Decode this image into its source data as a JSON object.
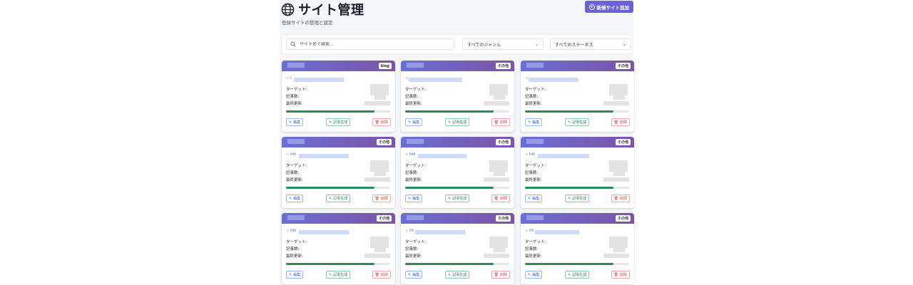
{
  "header": {
    "title": "サイト管理",
    "subtitle": "登録サイトの管理と設定",
    "add_button": "新規サイト追加"
  },
  "filters": {
    "search_placeholder": "サイト名で検索...",
    "genre_select": "すべてのジャンル",
    "status_select": "すべてのステータス"
  },
  "card_labels": {
    "target": "ターゲット:",
    "articles": "記事数:",
    "last_updated": "最終更新:",
    "edit": "編集",
    "generate": "記事生成",
    "delete": "削除"
  },
  "colors": {
    "accent": "#6a63d6",
    "header_gradient_start": "#6b6fd6",
    "header_gradient_end": "#7c53a8",
    "progress": "#2e8a5a",
    "edit": "#3a66d6",
    "generate": "#2e8a5a",
    "delete": "#d04545"
  },
  "sites": [
    {
      "genre": "blog",
      "url_prefix": "l",
      "progress": 0.85
    },
    {
      "genre": "その他",
      "url_prefix": "",
      "progress": 0.85
    },
    {
      "genre": "その他",
      "url_prefix": "",
      "progress": 0.85
    },
    {
      "genre": "その他",
      "url_prefix": "htt",
      "progress": 0.85
    },
    {
      "genre": "その他",
      "url_prefix": "htt",
      "progress": 0.85
    },
    {
      "genre": "その他",
      "url_prefix": "htt",
      "progress": 0.85
    },
    {
      "genre": "その他",
      "url_prefix": "htt",
      "progress": 0.85
    },
    {
      "genre": "その他",
      "url_prefix": "ht",
      "progress": 0.85
    },
    {
      "genre": "その他",
      "url_prefix": "ht",
      "progress": 0.85
    }
  ]
}
